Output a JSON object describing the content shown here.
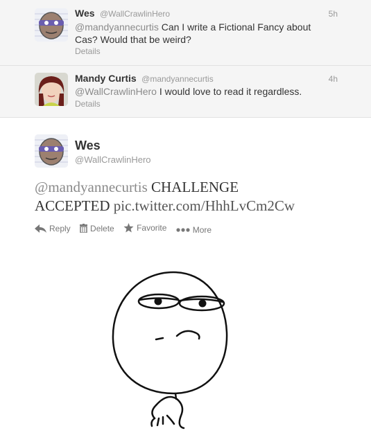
{
  "tweets": [
    {
      "name": "Wes",
      "handle": "@WallCrawlinHero",
      "time": "5h",
      "mention": "@mandyannecurtis",
      "text_line1": " Can I write a Fictional Fancy about",
      "text_line2": "Cas? Would that be weird?",
      "details": "Details",
      "avatar": "masked-cartoon-avatar"
    },
    {
      "name": "Mandy Curtis",
      "handle": "@mandyannecurtis",
      "time": "4h",
      "mention": "@WallCrawlinHero",
      "text_line1": " I would love to read it regardless.",
      "details": "Details",
      "avatar": "photo-avatar"
    }
  ],
  "main_tweet": {
    "name": "Wes",
    "handle": "@WallCrawlinHero",
    "mention": "@mandyannecurtis",
    "line1_rest": " CHALLENGE",
    "line2": "ACCEPTED ",
    "link": "pic.twitter.com/HhhLvCm2Cw",
    "actions": {
      "reply": "Reply",
      "delete": "Delete",
      "favorite": "Favorite",
      "more": "More"
    },
    "image": "challenge-accepted-meme"
  },
  "icons": {
    "reply": "reply-arrow-icon",
    "delete": "trash-icon",
    "favorite": "star-icon",
    "more": "ellipsis-icon"
  }
}
